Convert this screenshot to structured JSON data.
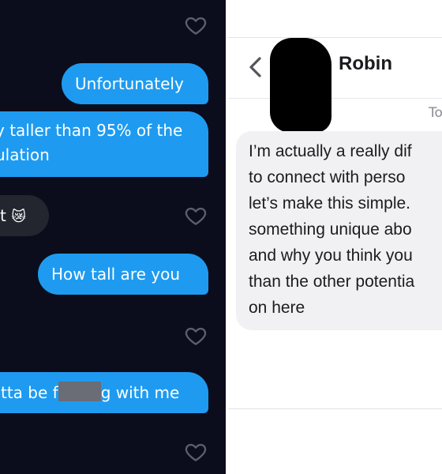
{
  "left_chat": {
    "messages": [
      {
        "side": "outgoing",
        "text": "Unfortunately"
      },
      {
        "side": "outgoing",
        "lines": [
          "y taller than 95% of the",
          "ulation"
        ]
      },
      {
        "side": "incoming",
        "text": "t",
        "emoji": "😿"
      },
      {
        "side": "outgoing",
        "text": "How tall are you"
      },
      {
        "side": "outgoing",
        "text_before": "tta be f",
        "text_after": "g with me",
        "redacted": true
      }
    ],
    "icons": [
      "heart-icon"
    ],
    "colors": {
      "background": "#0b0d1c",
      "outgoing_bubble": "#1e9bf0",
      "incoming_bubble": "#23252f"
    }
  },
  "right_chat": {
    "header": {
      "back_icon": "chevron-left-icon",
      "contact_name": "Robin"
    },
    "date_label": "To",
    "message_lines": [
      "I’m actually a really dif",
      "to connect with perso",
      "let’s make this simple.",
      "something unique abo",
      "and why you think you",
      "than the other potentia",
      "on here"
    ],
    "colors": {
      "background": "#ffffff",
      "incoming_bubble": "#f1f1f4"
    }
  }
}
